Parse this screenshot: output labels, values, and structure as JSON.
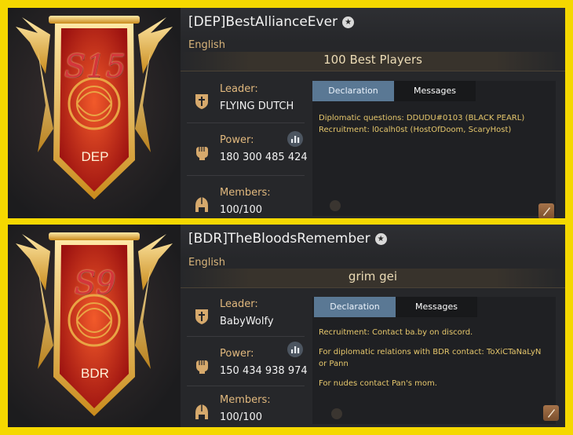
{
  "panels": [
    {
      "season": "S15",
      "tag": "DEP",
      "name": "[DEP]BestAllianceEver",
      "language": "English",
      "motto": "100 Best Players",
      "leader_label": "Leader:",
      "leader": "FLYING DUTCH",
      "power_label": "Power:",
      "power": "180 300 485 424",
      "members_label": "Members:",
      "members": "100/100",
      "tabs": [
        "Declaration",
        "Messages"
      ],
      "active_tab": "Declaration",
      "declaration": [
        "Diplomatic questions: DDUDU#0103 (BLACK PEARL)",
        "Recruitment: l0calh0st (HostOfDoom, ScaryHost)"
      ]
    },
    {
      "season": "S9",
      "tag": "BDR",
      "name": "[BDR]TheBloodsRemember",
      "language": "English",
      "motto": "grim gei",
      "leader_label": "Leader:",
      "leader": "BabyWolfy",
      "power_label": "Power:",
      "power": "150 434 938 974",
      "members_label": "Members:",
      "members": "100/100",
      "tabs": [
        "Declaration",
        "Messages"
      ],
      "active_tab": "Declaration",
      "declaration": [
        "Recruitment: Contact ba.by on discord.",
        "For diplomatic relations with BDR contact: ToXiCTaNaLyN or Pann",
        "For nudes contact Pan's mom."
      ]
    }
  ],
  "colors": {
    "frame": "#f5d800",
    "panel_bg": "#26272a",
    "label_gold": "#e2b97e",
    "declaration_text": "#e6c76c",
    "active_tab": "#5a7894"
  },
  "icons": {
    "leader": "shield-cross-icon",
    "power": "fist-icon",
    "members": "helmet-icon",
    "stats": "bar-chart-icon",
    "edit": "quill-edit-icon",
    "favorite": "star-icon"
  }
}
